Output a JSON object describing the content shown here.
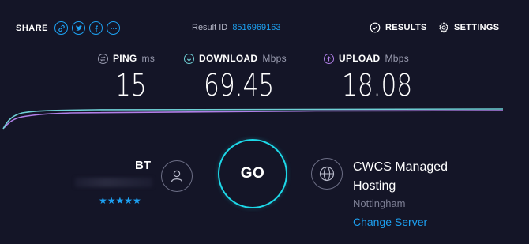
{
  "header": {
    "share_label": "SHARE",
    "result_id_label": "Result ID",
    "result_id_value": "8516969163",
    "results_label": "RESULTS",
    "settings_label": "SETTINGS"
  },
  "metrics": {
    "ping": {
      "label": "PING",
      "unit": "ms",
      "value": "15"
    },
    "download": {
      "label": "DOWNLOAD",
      "unit": "Mbps",
      "value": "69.45"
    },
    "upload": {
      "label": "UPLOAD",
      "unit": "Mbps",
      "value": "18.08"
    }
  },
  "isp": {
    "name": "BT",
    "rating": "★★★★★"
  },
  "go_label": "GO",
  "server": {
    "host": "CWCS Managed Hosting",
    "location": "Nottingham",
    "change_label": "Change Server"
  },
  "colors": {
    "background": "#141527",
    "accent_blue": "#1da1f2",
    "download_cyan": "#6fd0d6",
    "upload_purple": "#b07fe8",
    "go_ring": "#1dd8e8"
  }
}
